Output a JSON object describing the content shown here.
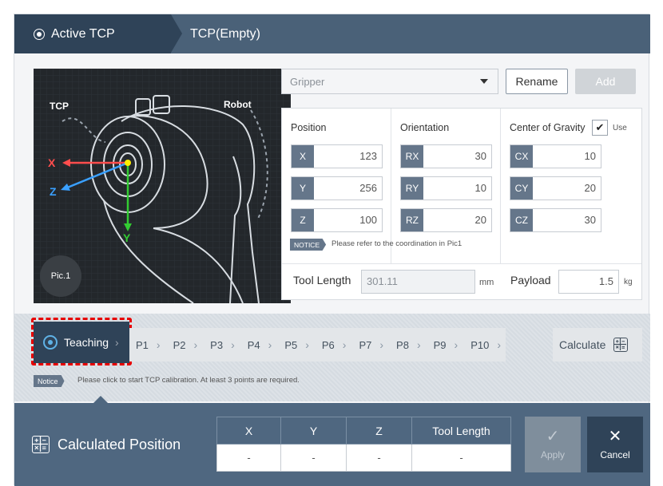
{
  "tabs": {
    "active_label": "Active TCP",
    "second_label": "TCP(Empty)"
  },
  "picture": {
    "tcp_label": "TCP",
    "robot_label": "Robot",
    "axis_x": "X",
    "axis_y": "Y",
    "axis_z": "Z",
    "pic_label": "Pic.1"
  },
  "toolbar": {
    "tool_select_value": "Gripper",
    "rename_label": "Rename",
    "add_label": "Add"
  },
  "position": {
    "title": "Position",
    "fields": [
      {
        "label": "X",
        "value": "123"
      },
      {
        "label": "Y",
        "value": "256"
      },
      {
        "label": "Z",
        "value": "100"
      }
    ]
  },
  "orientation": {
    "title": "Orientation",
    "fields": [
      {
        "label": "RX",
        "value": "30"
      },
      {
        "label": "RY",
        "value": "10"
      },
      {
        "label": "RZ",
        "value": "20"
      }
    ]
  },
  "cog": {
    "title": "Center of Gravity",
    "use_label": "Use",
    "use_checked": true,
    "fields": [
      {
        "label": "CX",
        "value": "10"
      },
      {
        "label": "CY",
        "value": "20"
      },
      {
        "label": "CZ",
        "value": "30"
      }
    ]
  },
  "panel_notice": {
    "badge": "NOTICE",
    "text": "Please refer to the coordination in Pic1"
  },
  "tool_length": {
    "label": "Tool Length",
    "value": "301.11",
    "unit": "mm"
  },
  "payload": {
    "label": "Payload",
    "value": "1.5",
    "unit": "kg"
  },
  "steps": {
    "teaching_label": "Teaching",
    "points": [
      "P1",
      "P2",
      "P3",
      "P4",
      "P5",
      "P6",
      "P7",
      "P8",
      "P9",
      "P10"
    ],
    "calculate_label": "Calculate"
  },
  "step_notice": {
    "badge": "Notice",
    "text": "Please click to start TCP calibration. At least 3 points are required."
  },
  "calculated": {
    "title": "Calculated Position",
    "headers": [
      "X",
      "Y",
      "Z",
      "Tool Length"
    ],
    "values": [
      "-",
      "-",
      "-",
      "-"
    ]
  },
  "actions": {
    "apply_label": "Apply",
    "cancel_label": "Cancel"
  },
  "colors": {
    "header_dark": "#2f4358",
    "header_bar": "#4a6178",
    "label_chip": "#65768a",
    "highlight": "#e60000",
    "axis_x": "#ff4d4d",
    "axis_y": "#33cc33",
    "axis_z": "#3aa0ff"
  }
}
